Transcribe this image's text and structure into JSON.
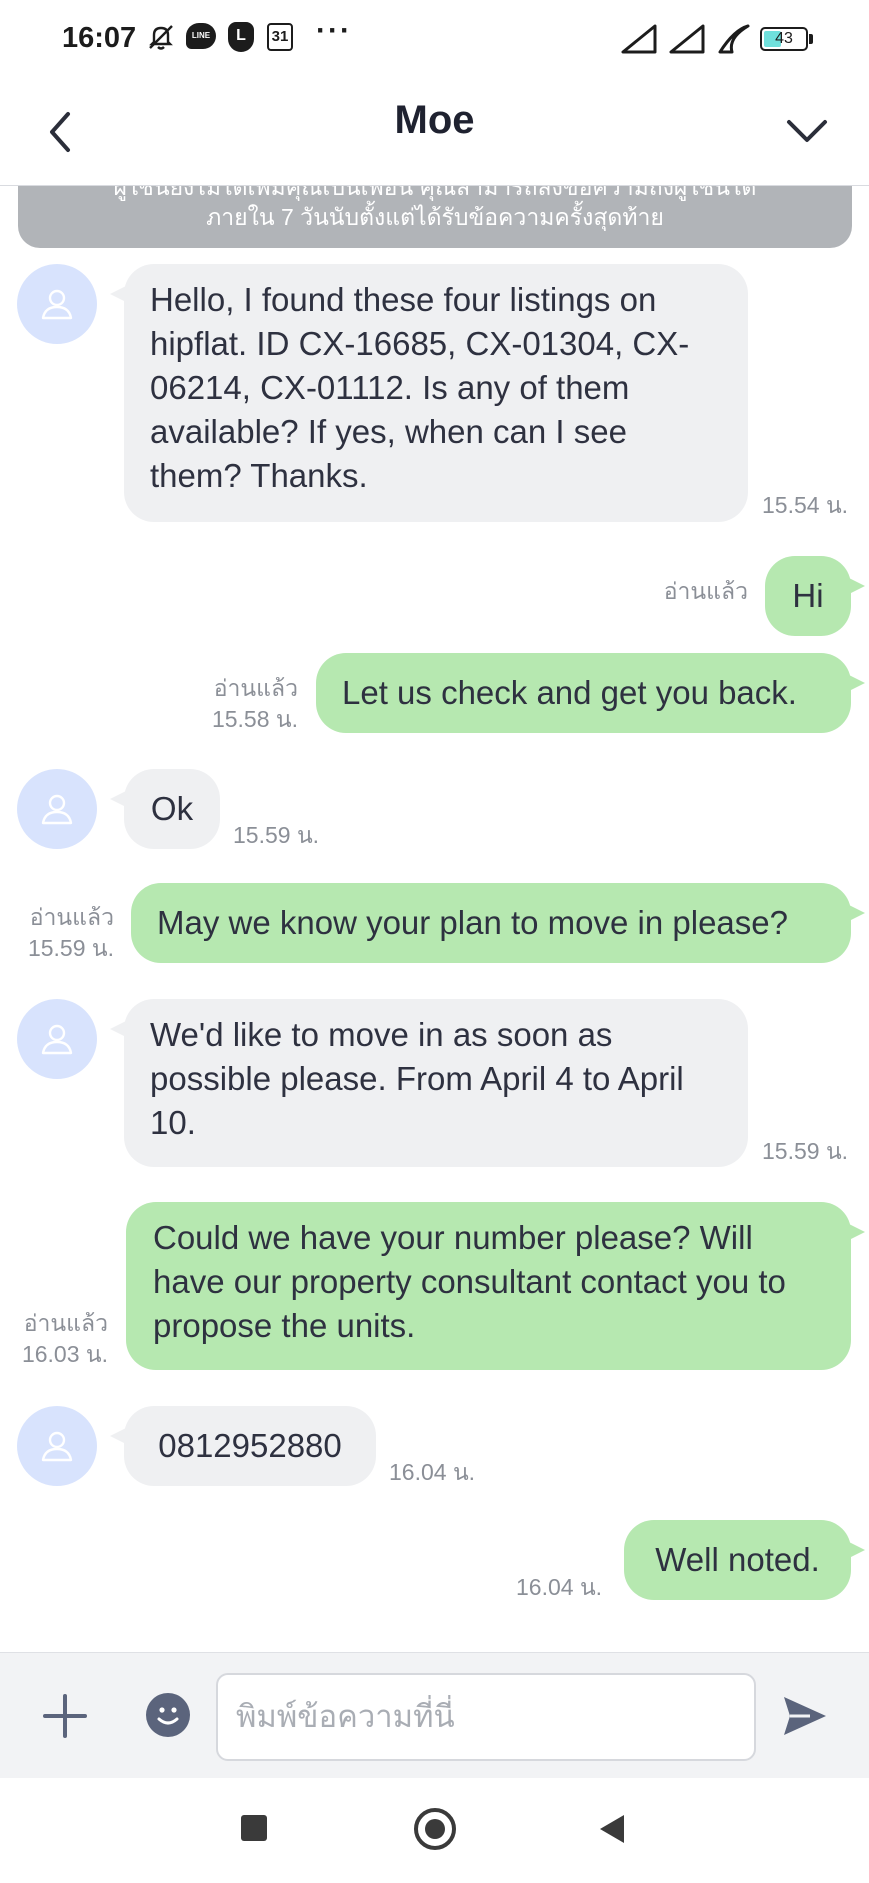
{
  "status_bar": {
    "time": "16:07",
    "icons": [
      "mute-icon",
      "line-app-icon",
      "l-app-icon",
      "calendar-icon",
      "more-dots-icon",
      "signal-icon",
      "signal-icon",
      "wifi-icon",
      "battery-icon"
    ],
    "calendar_label": "31",
    "line_label": "LINE",
    "l_label": "L",
    "more": "···",
    "battery_percent": "43",
    "battery_level": 0.43
  },
  "header": {
    "title": "Moe",
    "back_icon": "chevron-left-icon",
    "dropdown_icon": "chevron-down-icon"
  },
  "notice": {
    "line1": "ผู้ใช้นี้ยังไม่ได้เพิ่มคุณเป็นเพื่อน คุณสามารถส่งข้อความถึงผู้ใช้นี้ได้",
    "line2": "ภายใน 7 วันนับตั้งแต่ได้รับข้อความครั้งสุดท้าย"
  },
  "messages": [
    {
      "dir": "in",
      "text": "Hello, I found these four listings on hipflat. ID CX-16685, CX-01304, CX-06214, CX-01112. Is any of them available? If yes, when can I see them? Thanks.",
      "time": "15.54 น."
    },
    {
      "dir": "out",
      "text": "Hi",
      "read": "อ่านแล้ว",
      "time": ""
    },
    {
      "dir": "out",
      "text": "Let us check and get you back.",
      "read": "อ่านแล้ว",
      "time": "15.58 น."
    },
    {
      "dir": "in",
      "text": "Ok",
      "time": "15.59 น."
    },
    {
      "dir": "out",
      "text": "May we know your plan to move in please?",
      "read": "อ่านแล้ว",
      "time": "15.59 น."
    },
    {
      "dir": "in",
      "text": "We'd like to move in as soon as possible please. From April 4 to April 10.",
      "time": "15.59 น."
    },
    {
      "dir": "out",
      "text": "Could we have your number please? Will have our property consultant contact you to propose the units.",
      "read": "อ่านแล้ว",
      "time": "16.03 น."
    },
    {
      "dir": "in",
      "text": "0812952880",
      "time": "16.04 น."
    },
    {
      "dir": "out",
      "text": "Well noted.",
      "read": "",
      "time": "16.04 น."
    }
  ],
  "input_bar": {
    "placeholder": "พิมพ์ข้อความที่นี่",
    "value": "",
    "plus_icon": "plus-icon",
    "emoji_icon": "emoji-icon",
    "send_icon": "send-icon"
  },
  "nav_bar": {
    "icons": [
      "recents-square-icon",
      "home-circle-icon",
      "back-triangle-icon"
    ]
  },
  "colors": {
    "incoming_bubble": "#eff0f2",
    "outgoing_bubble": "#b6e8b0",
    "avatar_bg": "#d8e3fd",
    "notice_bg": "#b1b4b8",
    "meta_text": "#8b8f97"
  }
}
